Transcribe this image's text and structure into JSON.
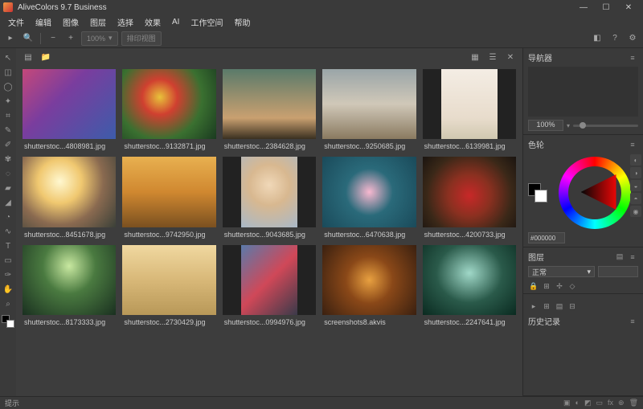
{
  "titlebar": {
    "title": "AliveColors 9.7 Business"
  },
  "menu": [
    "文件",
    "编辑",
    "图像",
    "图层",
    "选择",
    "效果",
    "AI",
    "工作空间",
    "帮助"
  ],
  "toolbar": {
    "zoom_value": "100%",
    "fit_label": "排印视图"
  },
  "gallery": {
    "items": [
      {
        "label": "shutterstoc...4808981.jpg",
        "bg": "bg-swans",
        "portrait": false
      },
      {
        "label": "shutterstoc...9132871.jpg",
        "bg": "bg-parrot",
        "portrait": false
      },
      {
        "label": "shutterstoc...2384628.jpg",
        "bg": "bg-woman-car",
        "portrait": false
      },
      {
        "label": "shutterstoc...9250685.jpg",
        "bg": "bg-woman-white",
        "portrait": false
      },
      {
        "label": "shutterstoc...6139981.jpg",
        "bg": "bg-bride",
        "portrait": true
      },
      {
        "label": "shutterstoc...8451678.jpg",
        "bg": "bg-sunset",
        "portrait": false
      },
      {
        "label": "shutterstoc...9742950.jpg",
        "bg": "bg-birch",
        "portrait": false
      },
      {
        "label": "shutterstoc...9043685.jpg",
        "bg": "bg-blonde",
        "portrait": true
      },
      {
        "label": "shutterstoc...6470638.jpg",
        "bg": "bg-lotus",
        "portrait": false
      },
      {
        "label": "shutterstoc...4200733.jpg",
        "bg": "bg-apples",
        "portrait": false
      },
      {
        "label": "shutterstoc...8173333.jpg",
        "bg": "bg-deer",
        "portrait": false
      },
      {
        "label": "shutterstoc...2730429.jpg",
        "bg": "bg-cats",
        "portrait": false
      },
      {
        "label": "shutterstoc...0994976.jpg",
        "bg": "bg-redhair",
        "portrait": true
      },
      {
        "label": "screenshots8.akvis",
        "bg": "bg-corgi",
        "portrait": false
      },
      {
        "label": "shutterstoc...2247641.jpg",
        "bg": "bg-jungle",
        "portrait": false
      }
    ]
  },
  "panels": {
    "navigator": {
      "title": "导航器",
      "zoom": "100%"
    },
    "color": {
      "title": "色轮",
      "hex": "#000000"
    },
    "layers": {
      "title": "图层",
      "blend_mode": "正常"
    },
    "history": {
      "title": "历史记录"
    }
  },
  "statusbar": {
    "hint_label": "提示"
  }
}
